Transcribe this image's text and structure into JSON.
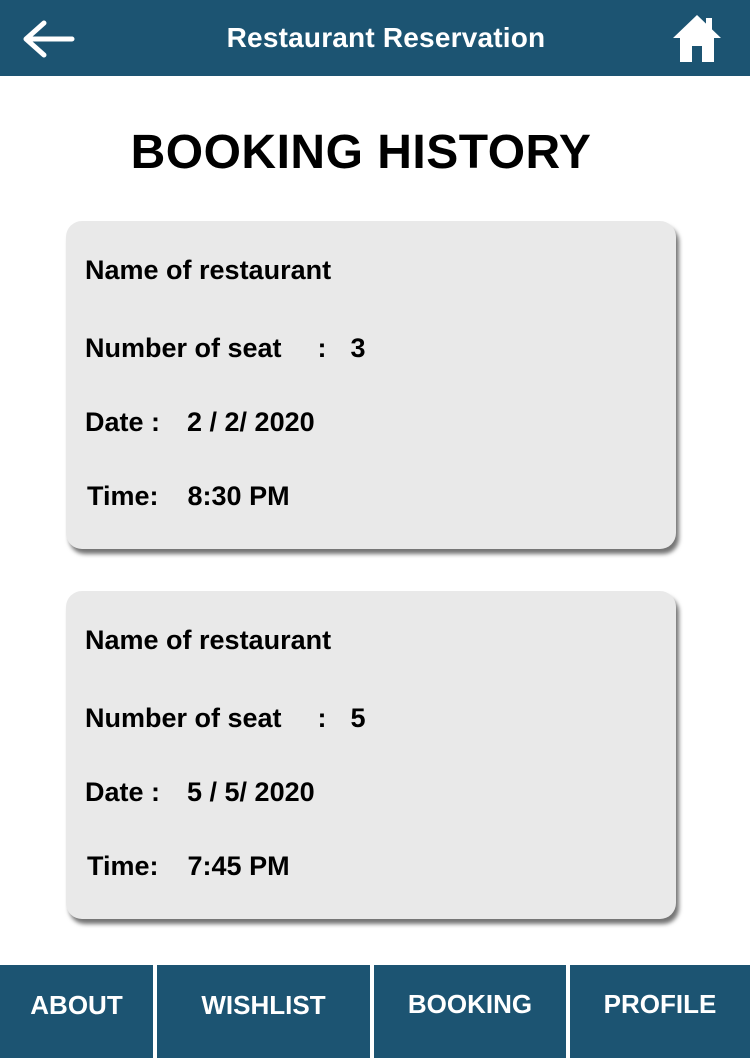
{
  "header": {
    "title": "Restaurant Reservation",
    "back_icon": "arrow-left-icon",
    "home_icon": "home-icon"
  },
  "page": {
    "heading": "BOOKING HISTORY"
  },
  "bookings": [
    {
      "name_label": "Name of restaurant",
      "seat_label": "Number of seat",
      "seat_sep": ":",
      "seats": "3",
      "date_label": "Date :",
      "date": "2 / 2/ 2020",
      "time_label": "Time:",
      "time": "8:30 PM"
    },
    {
      "name_label": "Name of restaurant",
      "seat_label": "Number of seat",
      "seat_sep": ":",
      "seats": "5",
      "date_label": "Date :",
      "date": "5 / 5/ 2020",
      "time_label": "Time:",
      "time": "7:45 PM"
    }
  ],
  "nav": {
    "about": "ABOUT",
    "wishlist": "WISHLIST",
    "booking": "BOOKING",
    "profile": "PROFILE"
  },
  "colors": {
    "primary": "#1c5472",
    "card": "#e9e9e9",
    "text": "#000000"
  }
}
